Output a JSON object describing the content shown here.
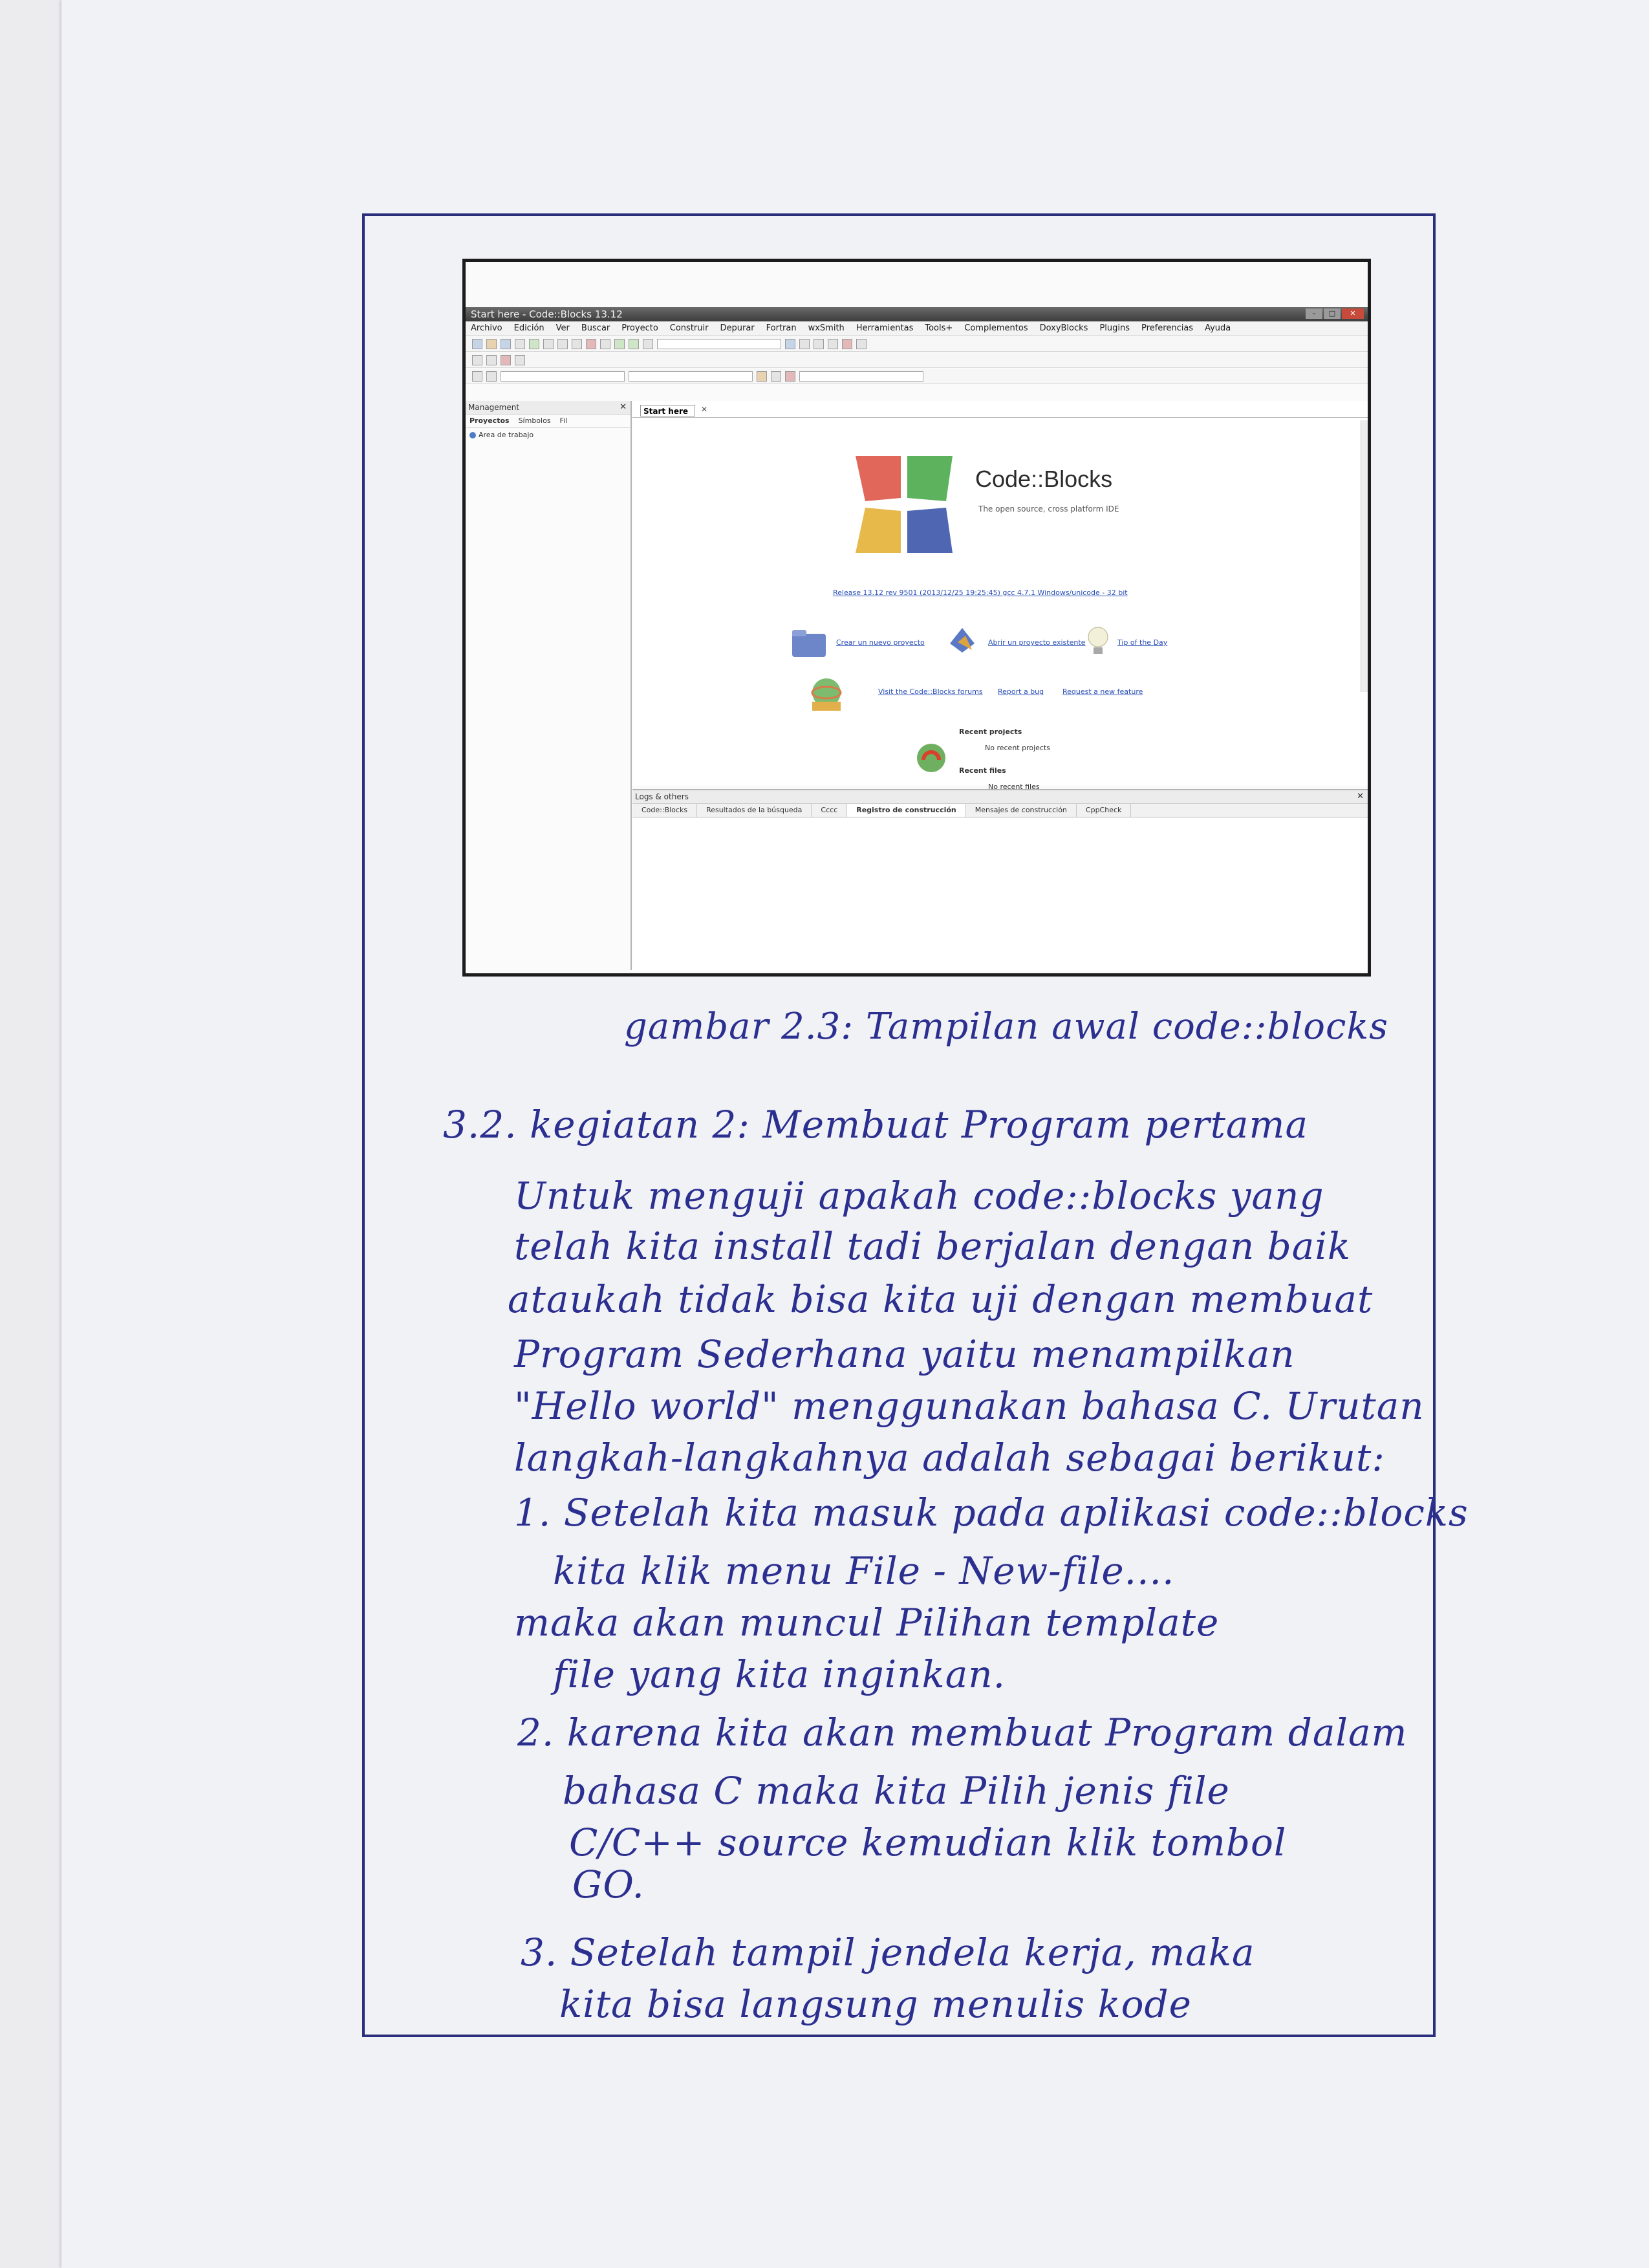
{
  "screenshot": {
    "window_title": "Start here - Code::Blocks 13.12",
    "menu": [
      "Archivo",
      "Edición",
      "Ver",
      "Buscar",
      "Proyecto",
      "Construir",
      "Depurar",
      "Fortran",
      "wxSmith",
      "Herramientas",
      "Tools+",
      "Complementos",
      "DoxyBlocks",
      "Plugins",
      "Preferencias",
      "Ayuda"
    ],
    "management": {
      "title": "Management",
      "tabs": [
        "Proyectos",
        "Símbolos",
        "Fil"
      ],
      "tree_item": "Area de trabajo"
    },
    "editor_tab": "Start here",
    "start_page": {
      "app_name": "Code::Blocks",
      "tagline": "The open source, cross platform IDE",
      "release": "Release 13.12 rev 9501 (2013/12/25 19:25:45) gcc 4.7.1 Windows/unicode - 32 bit",
      "create_project": "Crear un nuevo proyecto",
      "open_project": "Abrir un proyecto existente",
      "tip": "Tip of the Day",
      "forums": "Visit the Code::Blocks forums",
      "report_bug": "Report a bug",
      "request_feature": "Request a new feature",
      "recent_projects_label": "Recent projects",
      "no_recent_projects": "No recent projects",
      "recent_files_label": "Recent files",
      "no_recent_files": "No recent files"
    },
    "logs": {
      "title": "Logs & others",
      "tabs": [
        "Code::Blocks",
        "Resultados de la búsqueda",
        "Cccc",
        "Registro de construcción",
        "Mensajes de construcción",
        "CppCheck"
      ]
    },
    "logo_colors": [
      "#e0675a",
      "#5db35d",
      "#e7b94a",
      "#4f67b3"
    ]
  },
  "caption": "gambar 2.3: Tampilan awal code::blocks",
  "notes": [
    "3.2. kegiatan 2: Membuat Program pertama",
    "Untuk menguji apakah code::blocks yang",
    "telah kita install tadi berjalan dengan baik",
    "ataukah tidak bisa kita uji dengan membuat",
    "Program Sederhana yaitu menampilkan",
    "\"Hello world\" menggunakan bahasa C. Urutan",
    "langkah-langkahnya adalah sebagai berikut:",
    "1. Setelah kita masuk pada aplikasi code::blocks",
    "kita klik menu File - New-file....",
    "maka akan muncul Pilihan template",
    "file yang kita inginkan.",
    "2. karena kita akan membuat Program dalam",
    "bahasa C maka kita Pilih jenis file",
    "C/C++ source kemudian klik tombol",
    "GO.",
    "3. Setelah tampil jendela kerja, maka",
    "kita bisa langsung menulis kode"
  ],
  "ink_color": "#2b2f8f"
}
